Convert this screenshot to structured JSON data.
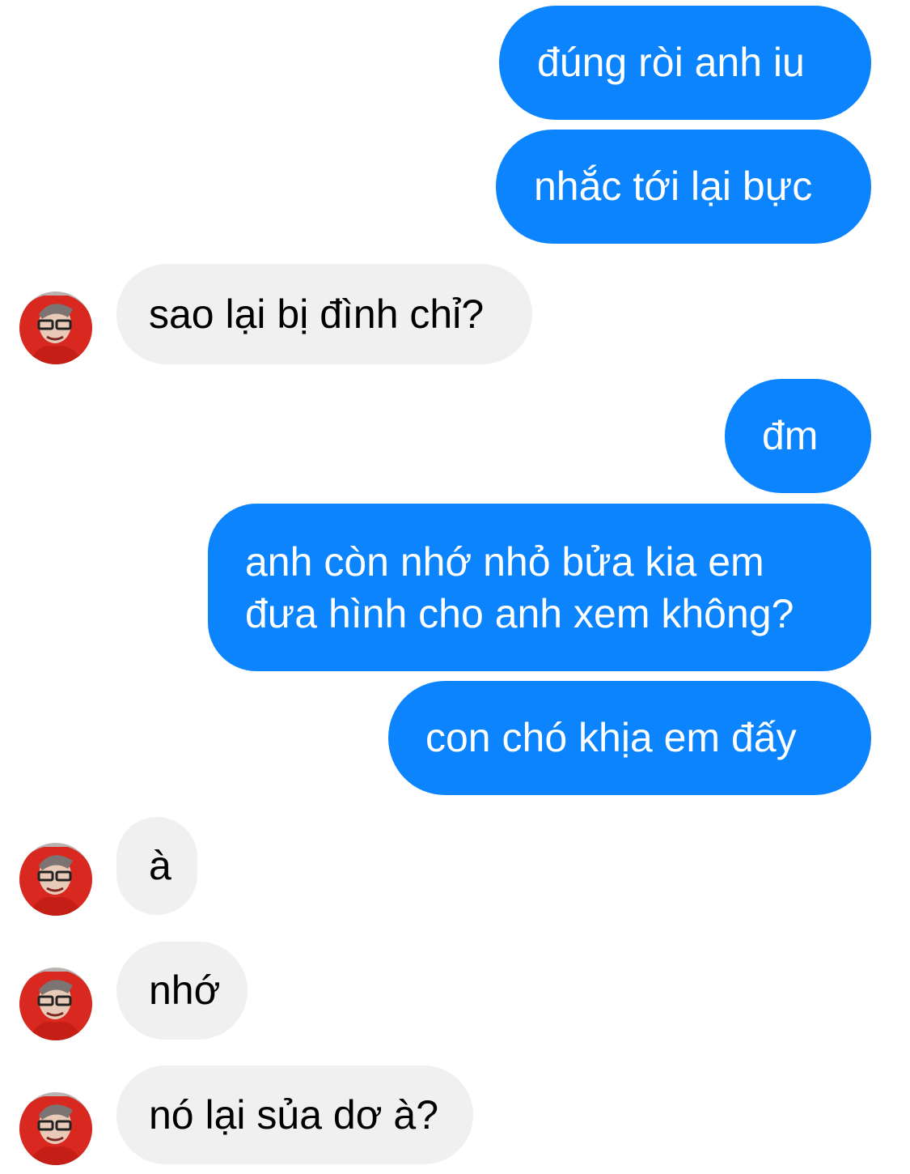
{
  "colors": {
    "outgoing_bubble": "#0b84fe",
    "incoming_bubble": "#f0f0f0",
    "background": "#ffffff"
  },
  "messages": [
    {
      "sender": "me",
      "text": "đúng ròi anh iu"
    },
    {
      "sender": "me",
      "text": "nhắc tới lại bực"
    },
    {
      "sender": "them",
      "text": "sao lại bị đình chỉ?"
    },
    {
      "sender": "me",
      "text": "đm"
    },
    {
      "sender": "me",
      "lines": [
        "anh còn nhớ nhỏ bửa kia em",
        "đưa hình cho anh xem không?"
      ]
    },
    {
      "sender": "me",
      "text": "con chó khịa em đấy"
    },
    {
      "sender": "them",
      "text": "à"
    },
    {
      "sender": "them",
      "text": "nhớ"
    },
    {
      "sender": "them",
      "text": "nó lại sủa dơ à?"
    }
  ],
  "avatar_icon": "contact-avatar-icon"
}
